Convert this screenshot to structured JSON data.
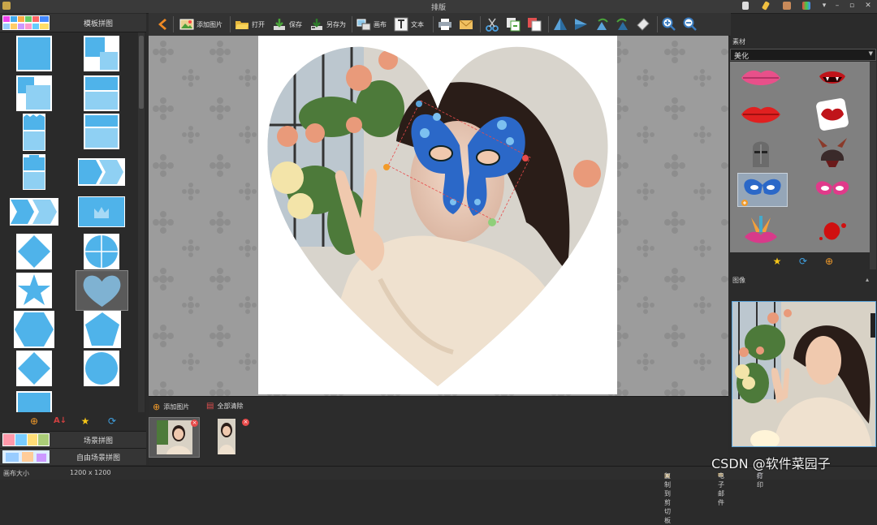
{
  "window": {
    "title": "排版"
  },
  "left_panel": {
    "header_label": "模板拼图",
    "tab_scene": "场景拼图",
    "tab_free": "自由场景拼图"
  },
  "toolbar": {
    "add_image": "添加图片",
    "open": "打开",
    "save": "保存",
    "save_as": "另存为",
    "canvas": "画布",
    "text": "文本"
  },
  "bottom": {
    "add_image": "添加图片",
    "clear_all": "全部清除"
  },
  "right_panel": {
    "material_header": "素材",
    "dropdown_value": "美化",
    "image_header": "图像"
  },
  "statusbar": {
    "canvas_size_label": "画布大小",
    "canvas_size_value": "1200 x 1200",
    "copy_clipboard": "复制到剪切板",
    "email": "电子邮件",
    "print": "打印"
  },
  "watermark": "CSDN @软件菜园子",
  "colors": {
    "template_blue": "#4fb3ea",
    "canvas_bg": "#9a9a9a",
    "accent": "#5aa3d9"
  }
}
